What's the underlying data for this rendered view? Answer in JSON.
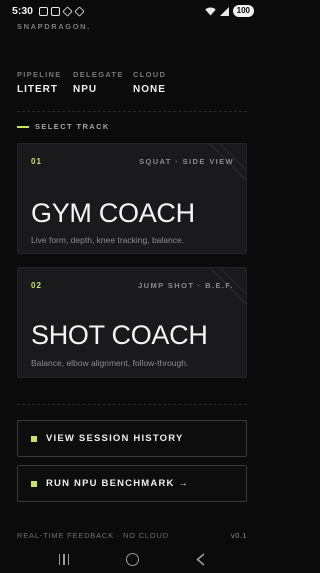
{
  "status_bar": {
    "time": "5:30",
    "notification_icons": [
      "notification-icon",
      "notification-icon",
      "notification-icon",
      "notification-icon"
    ],
    "battery": "100"
  },
  "brand": "SNAPDRAGON.",
  "stats": [
    {
      "key": "PIPELINE",
      "value": "LITERT"
    },
    {
      "key": "DELEGATE",
      "value": "NPU"
    },
    {
      "key": "CLOUD",
      "value": "NONE"
    }
  ],
  "section_label": "SELECT TRACK",
  "tracks": [
    {
      "index": "01",
      "tag": "SQUAT · SIDE VIEW",
      "title": "GYM COACH",
      "desc": "Live form, depth, knee tracking, balance."
    },
    {
      "index": "02",
      "tag": "JUMP SHOT · B.E.F.",
      "title": "SHOT COACH",
      "desc": "Balance, elbow alignment, follow-through."
    }
  ],
  "actions": {
    "history": "VIEW SESSION HISTORY",
    "benchmark": "RUN NPU BENCHMARK →"
  },
  "footer": {
    "left": "REAL-TIME FEEDBACK · NO CLOUD",
    "version": "v0.1"
  },
  "colors": {
    "accent": "#c9e265",
    "background": "#0b0b0c",
    "card": "#1a1a1c"
  }
}
